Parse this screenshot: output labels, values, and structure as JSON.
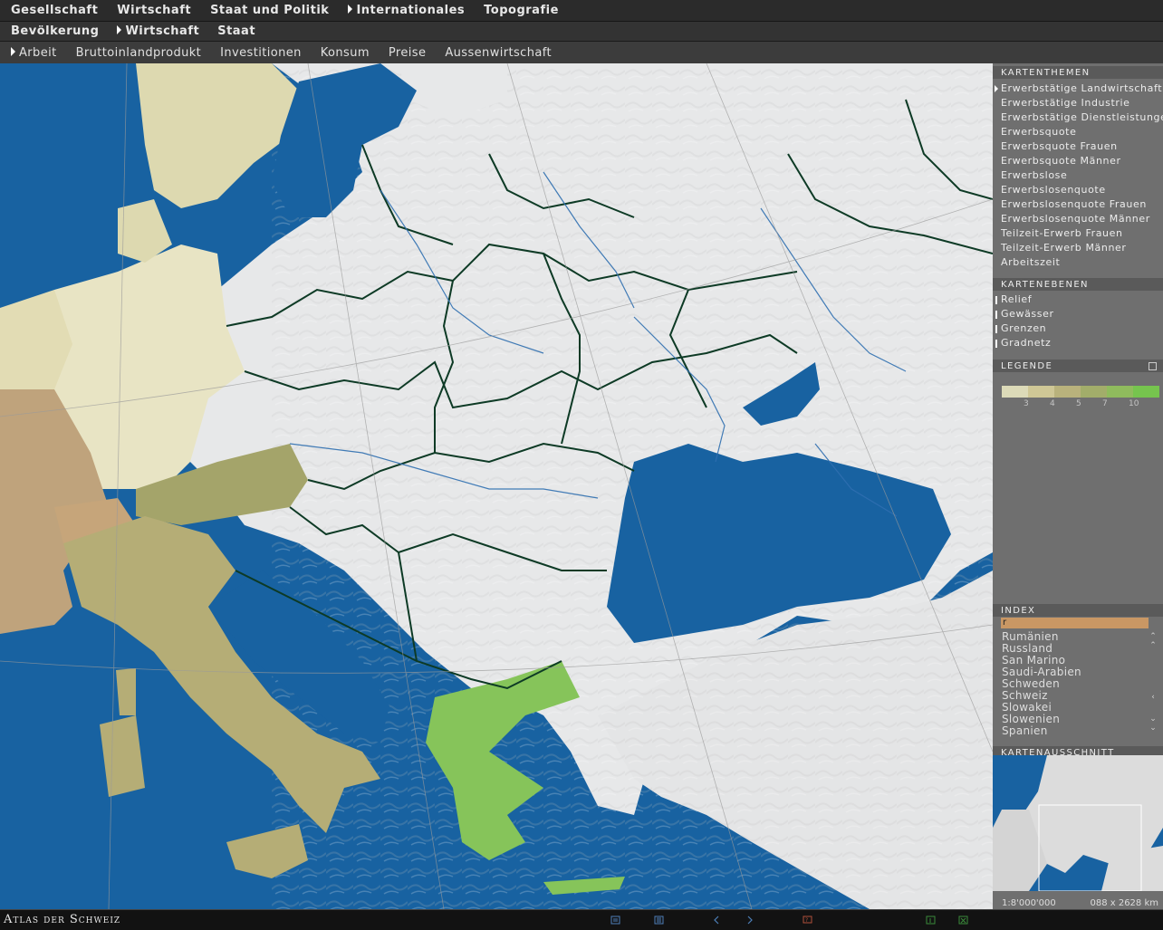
{
  "nav_primary": {
    "items": [
      {
        "label": "Gesellschaft",
        "active": false
      },
      {
        "label": "Wirtschaft",
        "active": false
      },
      {
        "label": "Staat und Politik",
        "active": false
      },
      {
        "label": "Internationales",
        "active": true
      },
      {
        "label": "Topografie",
        "active": false
      }
    ]
  },
  "nav_secondary": {
    "items": [
      {
        "label": "Bevölkerung",
        "active": false
      },
      {
        "label": "Wirtschaft",
        "active": true
      },
      {
        "label": "Staat",
        "active": false
      }
    ]
  },
  "nav_tertiary": {
    "items": [
      {
        "label": "Arbeit",
        "active": true
      },
      {
        "label": "Bruttoinlandprodukt",
        "active": false
      },
      {
        "label": "Investitionen",
        "active": false
      },
      {
        "label": "Konsum",
        "active": false
      },
      {
        "label": "Preise",
        "active": false
      },
      {
        "label": "Aussenwirtschaft",
        "active": false
      }
    ]
  },
  "panel": {
    "themes_title": "KARTENTHEMEN",
    "themes": [
      "Erwerbstätige  Landwirtschaft",
      "Erwerbstätige  Industrie",
      "Erwerbstätige  Dienstleistungen",
      "Erwerbsquote",
      "Erwerbsquote  Frauen",
      "Erwerbsquote  Männer",
      "Erwerbslose",
      "Erwerbslosenquote",
      "Erwerbslosenquote  Frauen",
      "Erwerbslosenquote  Männer",
      "Teilzeit-Erwerb  Frauen",
      "Teilzeit-Erwerb  Männer",
      "Arbeitszeit"
    ],
    "selected_theme": "Erwerbstätige  Landwirtschaft",
    "layers_title": "KARTENEBENEN",
    "layers": [
      "Relief",
      "Gewässer",
      "Grenzen",
      "Gradnetz"
    ],
    "legend_title": "LEGENDE",
    "legend_colors": [
      "#dcdab8",
      "#cfc796",
      "#b9b27c",
      "#a2ad6a",
      "#8fbb5d",
      "#76c44e"
    ],
    "legend_labels": [
      "3",
      "4",
      "5",
      "7",
      "10"
    ],
    "index_title": "INDEX",
    "index_query": "r",
    "index_items": [
      "Rumänien",
      "Russland",
      "San Marino",
      "Saudi-Arabien",
      "Schweden",
      "Schweiz",
      "Slowakei",
      "Slowenien",
      "Spanien"
    ],
    "minimap_title": "KARTENAUSSCHNITT",
    "scale": "1:8'000'000",
    "extent": "088 x 2628 km"
  },
  "footer": {
    "brand": "Atlas der Schweiz"
  }
}
